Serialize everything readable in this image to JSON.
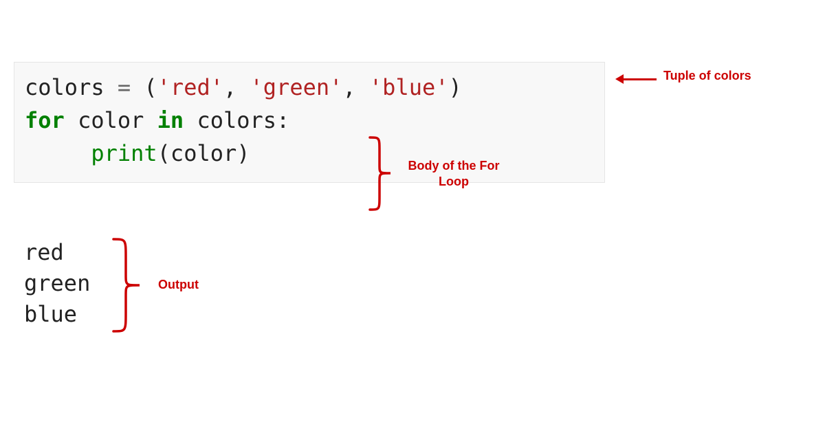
{
  "code": {
    "line1": {
      "var": "colors",
      "eq_space": " ",
      "eq": "=",
      "open": " (",
      "s1": "'red'",
      "c1": ", ",
      "s2": "'green'",
      "c2": ", ",
      "s3": "'blue'",
      "close": ")"
    },
    "line2_blank": "",
    "line3": {
      "kw_for": "for",
      "sp1": " ",
      "var1": "color",
      "sp2": " ",
      "kw_in": "in",
      "sp3": " ",
      "var2": "colors",
      "colon": ":"
    },
    "line4": {
      "indent": "     ",
      "func": "print",
      "open": "(",
      "arg": "color",
      "close": ")"
    }
  },
  "output": {
    "line1": "red",
    "line2": "green",
    "line3": "blue"
  },
  "annotations": {
    "tuple": "Tuple of colors",
    "body": "Body of the For Loop",
    "output": "Output"
  }
}
